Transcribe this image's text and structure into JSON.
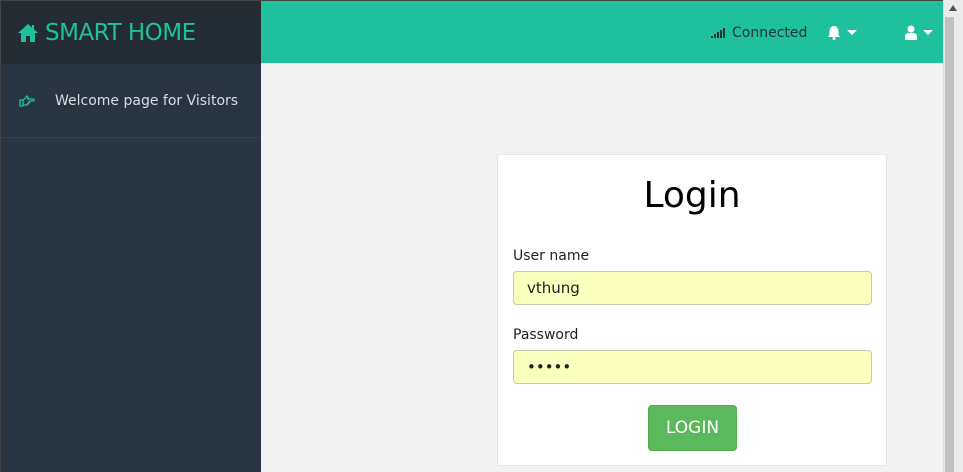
{
  "brand": {
    "title": "SMART HOME",
    "icon": "home-icon",
    "color": "#1fc19d"
  },
  "sidebar": {
    "items": [
      {
        "label": "Welcome page for Visitors",
        "icon": "hand-point-right-icon"
      }
    ]
  },
  "topbar": {
    "status_text": "Connected",
    "status_icon": "signal-icon",
    "notifications_icon": "bell-icon",
    "user_icon": "user-icon",
    "color": "#1fc19d"
  },
  "login": {
    "title": "Login",
    "username_label": "User name",
    "username_value": "vthung",
    "password_label": "Password",
    "password_value": "12345",
    "button_label": "LOGIN",
    "button_color": "#5cb85c"
  }
}
